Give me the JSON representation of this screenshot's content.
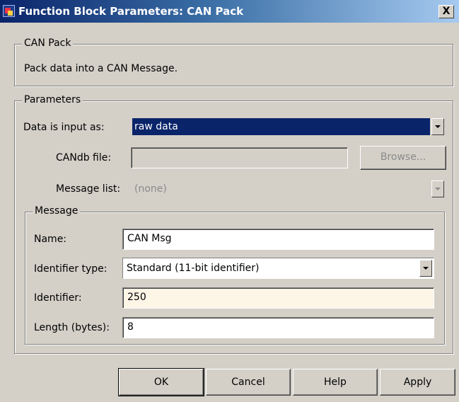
{
  "window": {
    "title": "Function Block Parameters: CAN Pack",
    "close_label": "X"
  },
  "description_group": {
    "legend": "CAN Pack",
    "text": "Pack data into a CAN Message."
  },
  "parameters_group": {
    "legend": "Parameters",
    "data_input": {
      "label": "Data is input as:",
      "value": "raw data"
    },
    "candb_file": {
      "label": "CANdb file:",
      "value": ""
    },
    "browse_button": "Browse...",
    "message_list": {
      "label": "Message list:",
      "value": "(none)"
    }
  },
  "message_group": {
    "legend": "Message",
    "name": {
      "label": "Name:",
      "value": "CAN Msg"
    },
    "identifier_type": {
      "label": "Identifier type:",
      "value": "Standard (11-bit identifier)"
    },
    "identifier": {
      "label": "Identifier:",
      "value": "250"
    },
    "length": {
      "label": "Length (bytes):",
      "value": "8"
    }
  },
  "buttons": {
    "ok": "OK",
    "cancel": "Cancel",
    "help": "Help",
    "apply": "Apply"
  }
}
